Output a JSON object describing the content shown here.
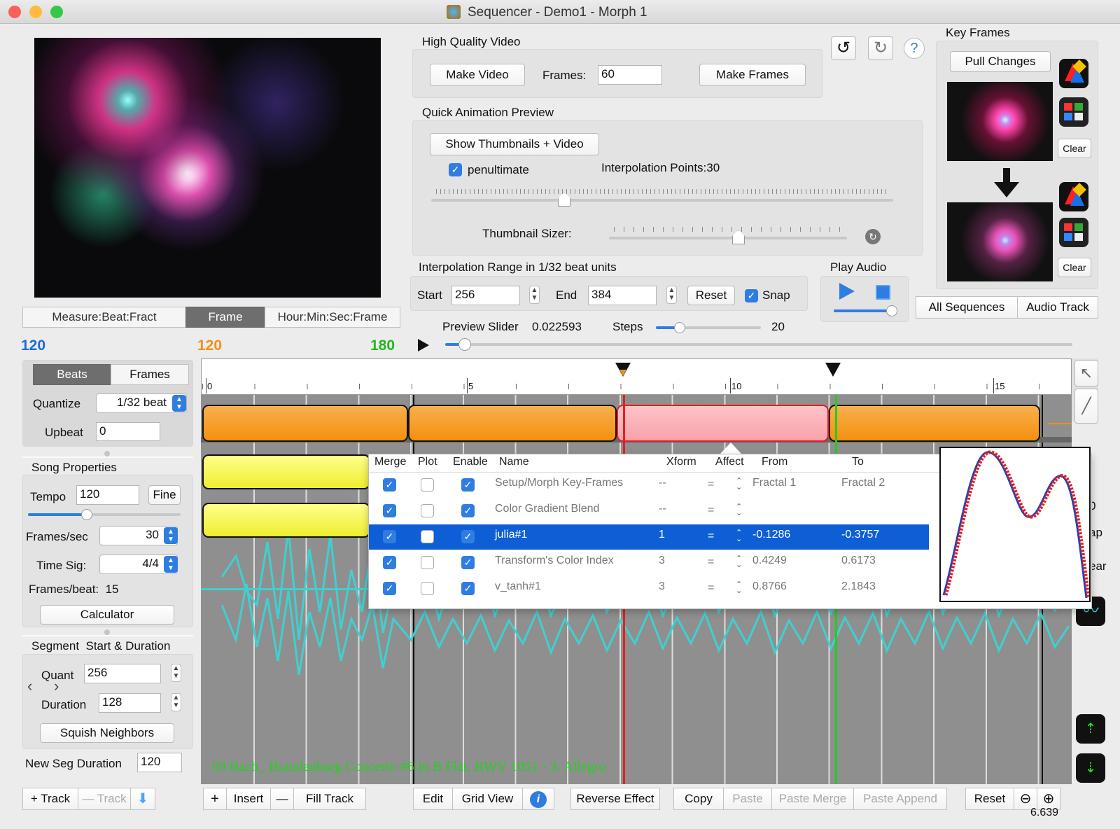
{
  "window": {
    "title": "Sequencer - Demo1 - Morph 1"
  },
  "preview": {
    "time_modes": [
      "Measure:Beat:Fract",
      "Frame",
      "Hour:Min:Sec:Frame"
    ],
    "selected_mode": "Frame"
  },
  "counters": {
    "left": "120",
    "mid": "120",
    "right": "180"
  },
  "hq_video": {
    "title": "High Quality Video",
    "make_video": "Make Video",
    "frames_label": "Frames:",
    "frames_value": "60",
    "make_frames": "Make Frames"
  },
  "quick": {
    "title": "Quick Animation Preview",
    "show_thumbs": "Show Thumbnails + Video",
    "penultimate": "penultimate",
    "interp_points": "Interpolation Points:30",
    "thumb_sizer": "Thumbnail Sizer:"
  },
  "interp_range": {
    "title": "Interpolation Range in 1/32 beat units",
    "start_label": "Start",
    "start_value": "256",
    "end_label": "End",
    "end_value": "384",
    "reset": "Reset",
    "snap": "Snap"
  },
  "play_audio": {
    "title": "Play Audio"
  },
  "preview_slider": {
    "label": "Preview Slider",
    "value": "0.022593",
    "steps_label": "Steps",
    "steps_value": "20"
  },
  "key_frames": {
    "title": "Key Frames",
    "pull_changes": "Pull Changes",
    "clear1": "Clear",
    "clear2": "Clear",
    "all_sequences": "All Sequences",
    "audio_track": "Audio Track"
  },
  "left_panel": {
    "beats": "Beats",
    "frames": "Frames",
    "quantize_label": "Quantize",
    "quantize_value": "1/32 beat",
    "upbeat_label": "Upbeat",
    "upbeat_value": "0",
    "song_title": "Song Properties",
    "tempo_label": "Tempo",
    "tempo_value": "120",
    "fine": "Fine",
    "fps_label": "Frames/sec",
    "fps_value": "30",
    "timesig_label": "Time Sig:",
    "timesig_value": "4/4",
    "fpb": "Frames/beat:  15",
    "calculator": "Calculator",
    "segment_title": "Segment  Start & Duration",
    "quant_label": "Quant",
    "quant_value": "256",
    "duration_label": "Duration",
    "duration_value": "128",
    "squish": "Squish Neighbors",
    "newseg_label": "New Seg Duration",
    "newseg_value": "120"
  },
  "ruler": {
    "labels": [
      "0",
      "5",
      "10",
      "15"
    ]
  },
  "table": {
    "headers": [
      "Merge",
      "Plot",
      "Enable",
      "Name",
      "Xform",
      "Affect",
      "From",
      "To"
    ],
    "rows": [
      {
        "name": "Setup/Morph Key-Frames",
        "xform": "--",
        "affect": "=",
        "from": "Fractal 1",
        "to": "Fractal 2",
        "merge": true,
        "plot": false,
        "enable": true,
        "selected": false
      },
      {
        "name": "Color Gradient Blend",
        "xform": "--",
        "affect": "=",
        "from": "",
        "to": "",
        "merge": true,
        "plot": false,
        "enable": true,
        "selected": false
      },
      {
        "name": "julia#1",
        "xform": "1",
        "affect": "=",
        "from": "-0.1286",
        "to": "-0.3757",
        "merge": true,
        "plot": false,
        "enable": true,
        "selected": true
      },
      {
        "name": "Transform's Color Index",
        "xform": "3",
        "affect": "=",
        "from": "0.4249",
        "to": "0.6173",
        "merge": true,
        "plot": false,
        "enable": true,
        "selected": false
      },
      {
        "name": "v_tanh#1",
        "xform": "3",
        "affect": "=",
        "from": "0.8766",
        "to": "2.1843",
        "merge": true,
        "plot": false,
        "enable": true,
        "selected": false
      }
    ]
  },
  "song_name": "09 Bach_ Brandenburg Concerto #6 In B Flat, BWV 1051 - 3. Allegro",
  "partial_labels": [
    "0",
    "ap",
    "ear"
  ],
  "bottom_left": {
    "add_track": "Track",
    "remove_track": "Track"
  },
  "bottom": {
    "insert": "Insert",
    "fill_track": "Fill Track",
    "edit": "Edit",
    "grid_view": "Grid View",
    "reverse_effect": "Reverse Effect",
    "copy": "Copy",
    "paste": "Paste",
    "paste_merge": "Paste Merge",
    "paste_append": "Paste Append",
    "reset": "Reset",
    "zoom": "6.639"
  },
  "colors": {
    "accent": "#2f7de1",
    "orange": "#f5900e",
    "pink": "#f7a2aa",
    "yellow": "#eeee30",
    "waveform": "#3fd0d0",
    "song_text": "#23d21c",
    "playhead_red": "#e02020",
    "playhead_green": "#22cc22"
  }
}
